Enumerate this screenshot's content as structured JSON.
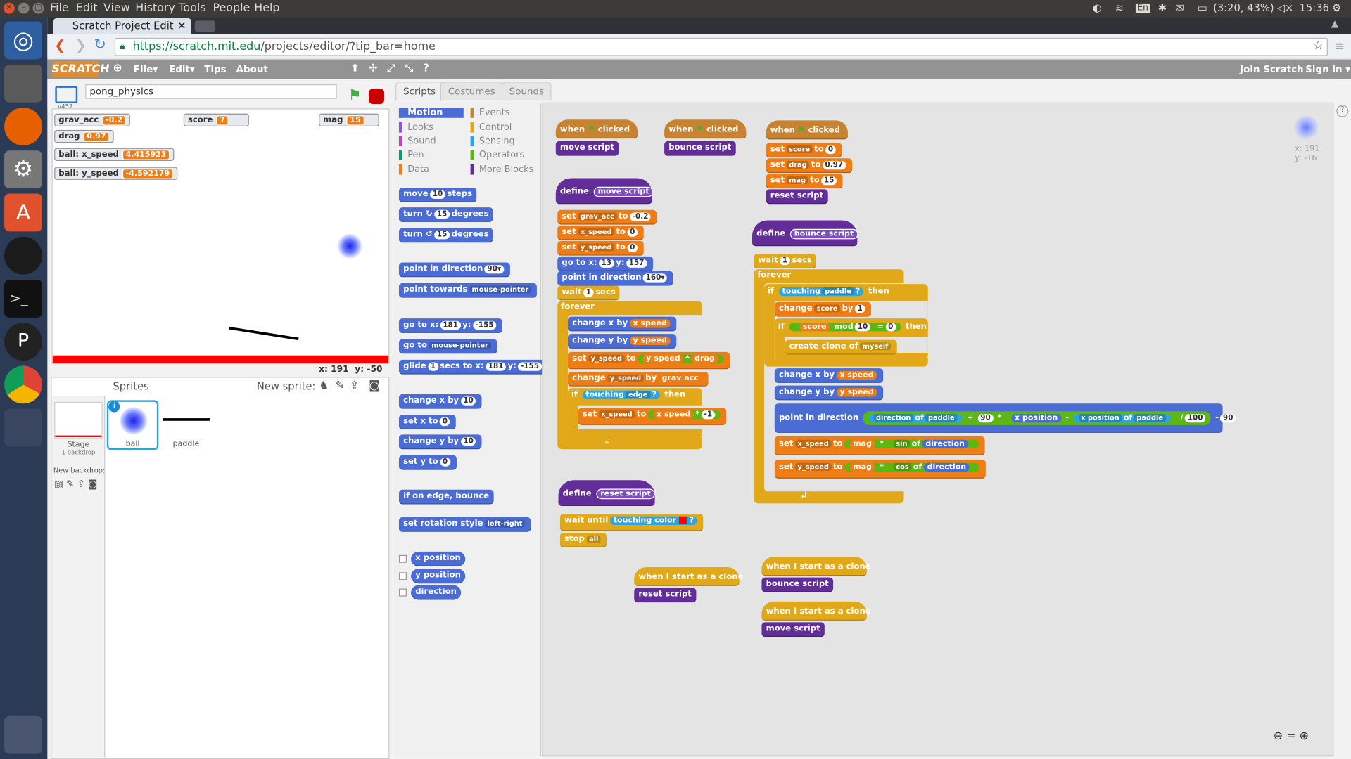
{
  "os": {
    "menus": [
      "File",
      "Edit",
      "View",
      "History",
      "Tools",
      "People",
      "Help"
    ],
    "battery": "(3:20, 43%)",
    "time": "15:36",
    "kb": "En"
  },
  "browser": {
    "tab_title": "Scratch Project Edit",
    "url_host": "https://scratch.mit.edu",
    "url_path": "/projects/editor/?tip_bar=home"
  },
  "scratch_nav": {
    "logo": "SCRATCH",
    "file": "File",
    "edit": "Edit",
    "tips": "Tips",
    "about": "About",
    "join": "Join Scratch",
    "signin": "Sign in"
  },
  "project": {
    "title": "pong_physics",
    "version": "v457"
  },
  "monitors": [
    {
      "label": "grav_acc",
      "value": "-0.2"
    },
    {
      "label": "score",
      "value": "7"
    },
    {
      "label": "mag",
      "value": "15"
    },
    {
      "label": "drag",
      "value": "0.97"
    },
    {
      "label": "ball: x_speed",
      "value": "4.415923"
    },
    {
      "label": "ball: y_speed",
      "value": "-4.592179"
    }
  ],
  "stage_coords": {
    "x": "x: 191",
    "y": "y: -50"
  },
  "sprites_panel": {
    "title": "Sprites",
    "new_sprite": "New sprite:",
    "stage_label": "Stage",
    "backdrops": "1 backdrop",
    "new_backdrop": "New backdrop:",
    "sprites": [
      "ball",
      "paddle"
    ]
  },
  "tabs": [
    "Scripts",
    "Costumes",
    "Sounds"
  ],
  "categories_left": [
    "Motion",
    "Looks",
    "Sound",
    "Pen",
    "Data"
  ],
  "categories_right": [
    "Events",
    "Control",
    "Sensing",
    "Operators",
    "More Blocks"
  ],
  "palette": {
    "move": "move",
    "steps": "steps",
    "move_n": "10",
    "turn": "turn",
    "degrees": "degrees",
    "turn_n": "15",
    "point_dir": "point in direction",
    "dir_n": "90▾",
    "point_towards": "point towards",
    "mouse": "mouse-pointer",
    "goto": "go to x:",
    "goto_x": "181",
    "y": "y:",
    "goto_y": "-155",
    "goto2": "go to",
    "glide": "glide",
    "secs_to_x": "secs to x:",
    "glide_n": "1",
    "change_x": "change x by",
    "change_y": "change y by",
    "set_x": "set x to",
    "set_y": "set y to",
    "ten": "10",
    "zero": "0",
    "bounce": "if on edge, bounce",
    "rot": "set rotation style",
    "rot_v": "left-right",
    "xpos": "x position",
    "ypos": "y position",
    "direction": "direction"
  },
  "scripts_coords": {
    "x": "x: 191",
    "y": "y: -16"
  },
  "script_text": {
    "when": "when",
    "clicked": "clicked",
    "move_script": "move script",
    "bounce_script": "bounce script",
    "reset_script": "reset script",
    "define": "define",
    "set": "set",
    "to": "to",
    "score": "score",
    "drag": "drag",
    "mag": "mag",
    "zero": "0",
    "drag_v": "0.97",
    "mag_v": "15",
    "grav_acc": "grav_acc",
    "grav_v": "-0.2",
    "x_speed": "x_speed",
    "y_speed": "y_speed",
    "goto": "go to x:",
    "gx": "13",
    "gy": "157",
    "y": "y:",
    "point": "point in direction",
    "pd": "160▾",
    "wait": "wait",
    "secs": "secs",
    "one": "1",
    "forever": "forever",
    "change_x": "change x by",
    "change_y": "change y by",
    "xs": "x speed",
    "ys": "y speed",
    "times": "*",
    "drag_r": "drag",
    "change": "change",
    "by": "by",
    "grav_r": "grav acc",
    "if": "if",
    "then": "then",
    "touching": "touching",
    "edge": "edge",
    "q": "?",
    "neg1": "-1",
    "paddle": "paddle",
    "mod": "mod",
    "ten": "10",
    "eq": "=",
    "clone": "create clone of",
    "myself": "myself",
    "of": "of",
    "plus": "+",
    "ninety": "90",
    "xpos": "x position",
    "minus": "-",
    "div": "/",
    "hundred": "100",
    "sin": "sin",
    "cos": "cos",
    "dir": "direction",
    "wait_until": "wait until",
    "touching_color": "touching color",
    "stop": "stop",
    "all": "all",
    "start_clone": "when I start as a clone"
  }
}
